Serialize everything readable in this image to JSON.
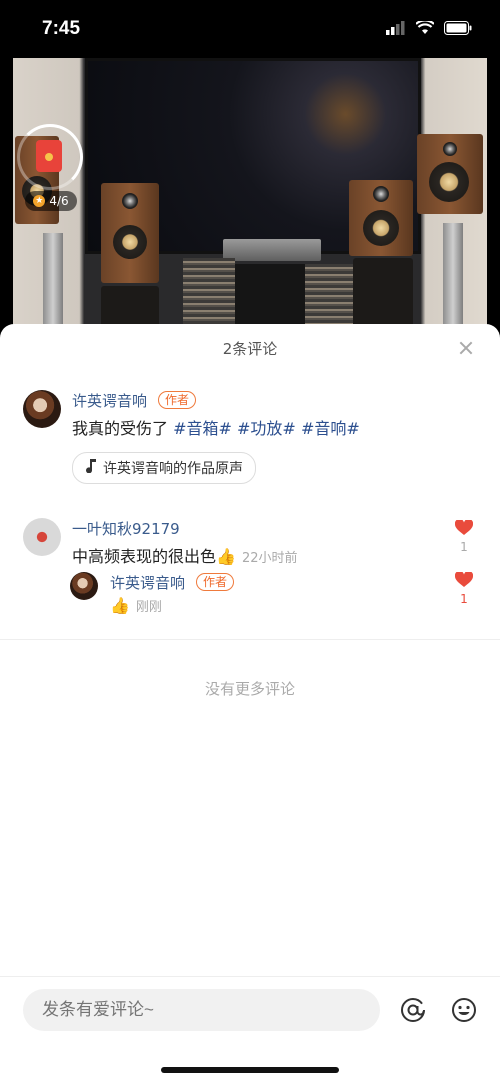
{
  "status_bar": {
    "time": "7:45"
  },
  "video": {
    "red_packet": {
      "progress_text": "4/6"
    }
  },
  "sheet": {
    "title": "2条评论",
    "comments": [
      {
        "user": "许英谔音响",
        "author_tag": "作者",
        "text_plain": "我真的受伤了 ",
        "hashtags": [
          "#音箱#",
          "#功放#",
          "#音响#"
        ],
        "sound_chip": "许英谔音响的作品原声"
      },
      {
        "user": "一叶知秋92179",
        "text": "中高频表现的很出色👍",
        "time": "22小时前",
        "likes": "1",
        "reply": {
          "user": "许英谔音响",
          "author_tag": "作者",
          "text": "👍",
          "time": "刚刚",
          "likes": "1"
        }
      }
    ],
    "no_more": "没有更多评论"
  },
  "bottom_bar": {
    "placeholder": "发条有爱评论~"
  },
  "colors": {
    "link": "#3a5b8c",
    "author_tag": "#ef6a2c",
    "heart": "#e94b3c"
  }
}
